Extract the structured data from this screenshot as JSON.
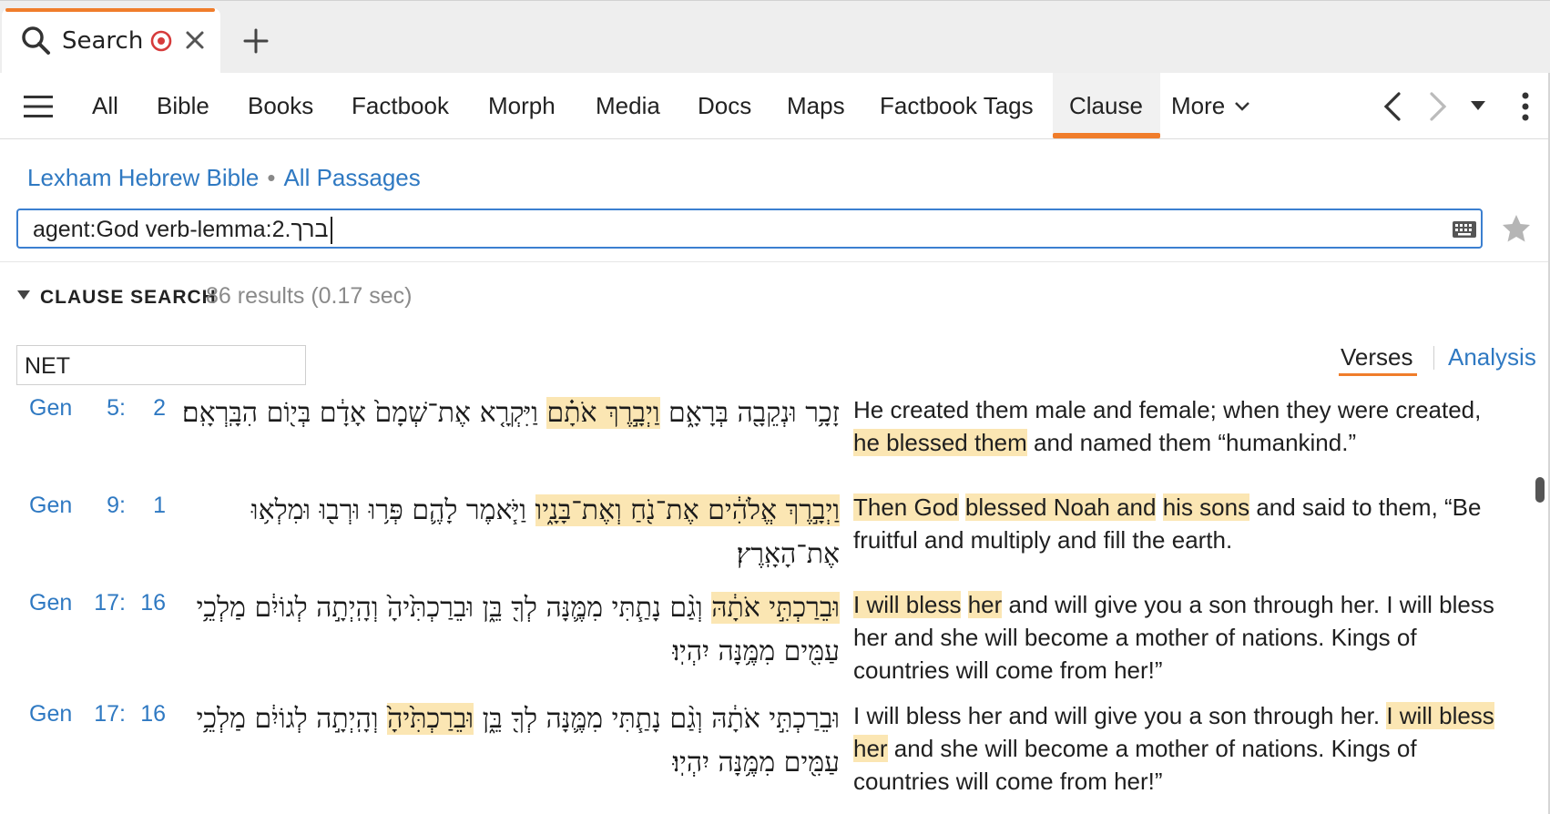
{
  "tab": {
    "label": "Search",
    "search_icon": "search-icon",
    "target_icon": "target-icon",
    "close_icon": "close-icon",
    "new_tab_icon": "plus-icon"
  },
  "nav": {
    "items": [
      "All",
      "Bible",
      "Books",
      "Factbook",
      "Morph",
      "Media",
      "Docs",
      "Maps",
      "Factbook Tags",
      "Clause"
    ],
    "active": "Clause",
    "more_label": "More",
    "accent": "#f07d2b"
  },
  "breadcrumb": {
    "resource": "Lexham Hebrew Bible",
    "separator": "•",
    "range": "All Passages"
  },
  "query": {
    "value": "agent:God verb-lemma:2.ברך"
  },
  "section": {
    "title": "CLAUSE SEARCH",
    "count": "86 results (0.17 sec)"
  },
  "version": {
    "value": "NET"
  },
  "views": {
    "verses": "Verses",
    "analysis": "Analysis"
  },
  "colors": {
    "link": "#2f79c2",
    "highlight": "#fbe6b3",
    "query_border": "#3b7fd0"
  },
  "results": [
    {
      "book": "Gen",
      "chapter": "5:",
      "verse": "2",
      "hebrew": [
        {
          "t": "זָכָ֥ר וּנְקֵבָ֖ה בְּרָאָ֑ם ",
          "h": false
        },
        {
          "t": "וַיְבָ֣רֶךְ אֹתָ֗ם",
          "h": true
        },
        {
          "t": " וַיִּקְרָ֤א אֶת־שְׁמָם֙ אָדָ֔ם בְּי֖וֹם הִבָּֽרְאָֽם׃",
          "h": false
        }
      ],
      "english": [
        {
          "t": "He created them male and female; when they were created, ",
          "h": false
        },
        {
          "t": "he blessed them",
          "h": true
        },
        {
          "t": " and named them “humankind.”",
          "h": false
        }
      ]
    },
    {
      "book": "Gen",
      "chapter": "9:",
      "verse": "1",
      "hebrew": [
        {
          "t": "וַיְבָ֣רֶךְ אֱלֹהִ֔ים אֶת־נֹ֖חַ וְאֶת־בָּנָ֑יו",
          "h": true
        },
        {
          "t": " וַיֹּ֧אמֶר לָהֶ֛ם פְּר֥וּ וּרְב֖וּ וּמִלְא֥וּ אֶת־הָאָֽרֶץ׃",
          "h": false
        }
      ],
      "english": [
        {
          "t": "Then God",
          "h": true
        },
        {
          "t": " ",
          "h": false
        },
        {
          "t": "blessed Noah and",
          "h": true
        },
        {
          "t": " ",
          "h": false
        },
        {
          "t": "his sons",
          "h": true
        },
        {
          "t": " and said to them, “Be fruitful and multiply and fill the earth.",
          "h": false
        }
      ]
    },
    {
      "book": "Gen",
      "chapter": "17:",
      "verse": "16",
      "hebrew": [
        {
          "t": "וּבֵרַכְתִּ֣י אֹתָ֔הּ",
          "h": true
        },
        {
          "t": " וְגַ֨ם נָתַ֧תִּי מִמֶּ֛נָּה לְךָ֖ בֵּ֑ן וּבֵרַכְתִּ֙יהָ֙ וְהָֽיְתָ֣ה לְגוֹיִ֔ם מַלְכֵ֥י עַמִּ֖ים מִמֶּ֥נָּה יִהְיֽוּ׃",
          "h": false
        }
      ],
      "english": [
        {
          "t": "I will bless",
          "h": true
        },
        {
          "t": " ",
          "h": false
        },
        {
          "t": "her",
          "h": true
        },
        {
          "t": " and will give you a son through her. I will bless her and she will become a mother of nations. Kings of countries will come from her!”",
          "h": false
        }
      ]
    },
    {
      "book": "Gen",
      "chapter": "17:",
      "verse": "16",
      "hebrew": [
        {
          "t": "וּבֵרַכְתִּ֣י אֹתָ֔הּ וְגַ֨ם נָתַ֧תִּי מִמֶּ֛נָּה לְךָ֖ בֵּ֑ן ",
          "h": false
        },
        {
          "t": "וּבֵרַכְתִּ֙יהָ֙",
          "h": true
        },
        {
          "t": " וְהָֽיְתָ֣ה לְגוֹיִ֔ם מַלְכֵ֥י עַמִּ֖ים מִמֶּ֥נָּה יִהְיֽוּ׃",
          "h": false
        }
      ],
      "english": [
        {
          "t": "I will bless her and will give you a son through her. ",
          "h": false
        },
        {
          "t": "I will bless her",
          "h": true
        },
        {
          "t": " and she will become a mother of nations. Kings of countries will come from her!”",
          "h": false
        }
      ]
    }
  ]
}
